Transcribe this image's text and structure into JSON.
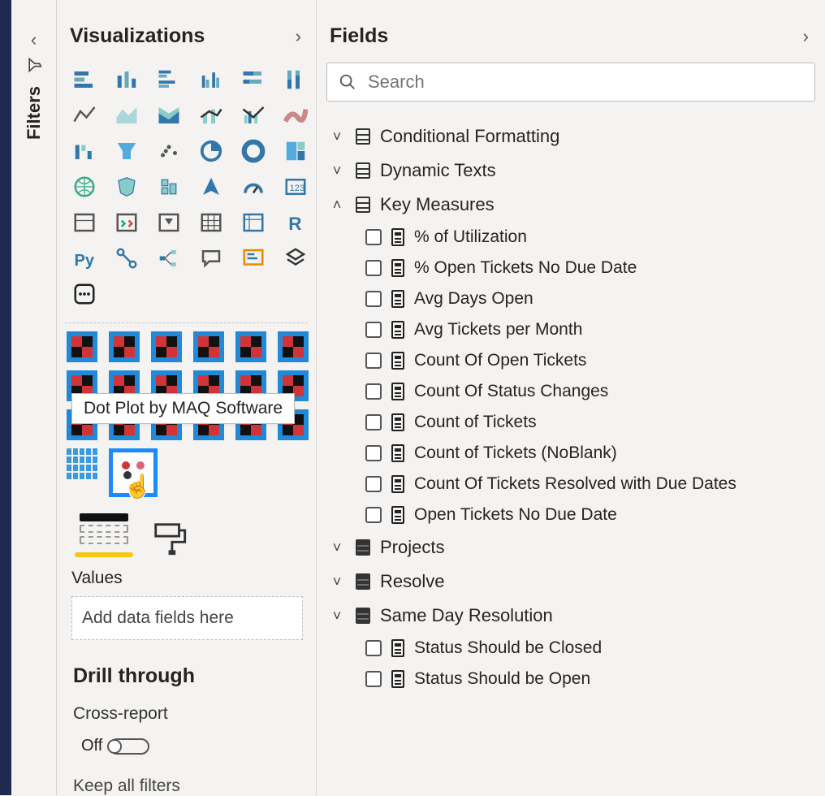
{
  "filters": {
    "label": "Filters"
  },
  "visualizations": {
    "title": "Visualizations",
    "tooltip": "Dot Plot by MAQ Software",
    "values_label": "Values",
    "drop_placeholder": "Add data fields here",
    "drill_title": "Drill through",
    "cross_report_label": "Cross-report",
    "toggle_state": "Off",
    "keep_filters_label": "Keep all filters"
  },
  "fields": {
    "title": "Fields",
    "search_placeholder": "Search",
    "tables": [
      {
        "name": "Conditional Formatting",
        "expanded": false,
        "icon": "table"
      },
      {
        "name": "Dynamic Texts",
        "expanded": false,
        "icon": "table"
      },
      {
        "name": "Key Measures",
        "expanded": true,
        "icon": "table",
        "measures": [
          "% of Utilization",
          "% Open Tickets No Due Date",
          "Avg Days Open",
          "Avg Tickets per Month",
          "Count Of Open Tickets",
          "Count Of Status Changes",
          "Count of Tickets",
          "Count of Tickets (NoBlank)",
          "Count Of Tickets Resolved with Due Dates",
          "Open Tickets No Due Date"
        ]
      },
      {
        "name": "Projects",
        "expanded": false,
        "icon": "folder"
      },
      {
        "name": "Resolve",
        "expanded": false,
        "icon": "folder"
      },
      {
        "name": "Same Day Resolution",
        "expanded": false,
        "icon": "folder",
        "measures": [
          "Status Should be Closed",
          "Status Should be Open"
        ]
      }
    ]
  }
}
